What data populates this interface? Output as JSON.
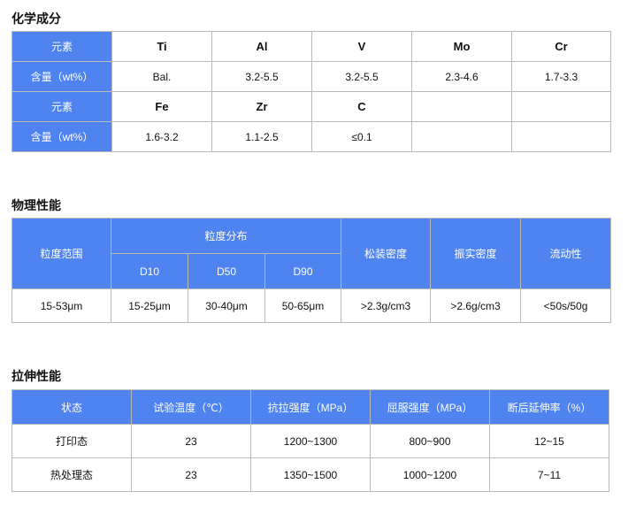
{
  "composition": {
    "title": "化学成分",
    "label_element": "元素",
    "label_content": "含量（wt%）",
    "row1_elements": [
      "Ti",
      "Al",
      "V",
      "Mo",
      "Cr"
    ],
    "row1_values": [
      "Bal.",
      "3.2-5.5",
      "3.2-5.5",
      "2.3-4.6",
      "1.7-3.3"
    ],
    "row2_elements": [
      "Fe",
      "Zr",
      "C"
    ],
    "row2_values": [
      "1.6-3.2",
      "1.1-2.5",
      "≤0.1"
    ]
  },
  "physical": {
    "title": "物理性能",
    "headers": {
      "particle_range": "粒度范围",
      "particle_distribution": "粒度分布",
      "d10": "D10",
      "d50": "D50",
      "d90": "D90",
      "apparent_density": "松装密度",
      "tap_density": "振实密度",
      "flowability": "流动性"
    },
    "values": {
      "particle_range": "15-53μm",
      "d10": "15-25μm",
      "d50": "30-40μm",
      "d90": "50-65μm",
      "apparent_density": ">2.3g/cm3",
      "tap_density": ">2.6g/cm3",
      "flowability": "<50s/50g"
    }
  },
  "tensile": {
    "title": "拉伸性能",
    "headers": [
      "状态",
      "试验温度（℃）",
      "抗拉强度（MPa）",
      "屈服强度（MPa）",
      "断后延伸率（%）"
    ],
    "rows": [
      [
        "打印态",
        "23",
        "1200~1300",
        "800~900",
        "12~15"
      ],
      [
        "热处理态",
        "23",
        "1350~1500",
        "1000~1200",
        "7~11"
      ]
    ]
  }
}
